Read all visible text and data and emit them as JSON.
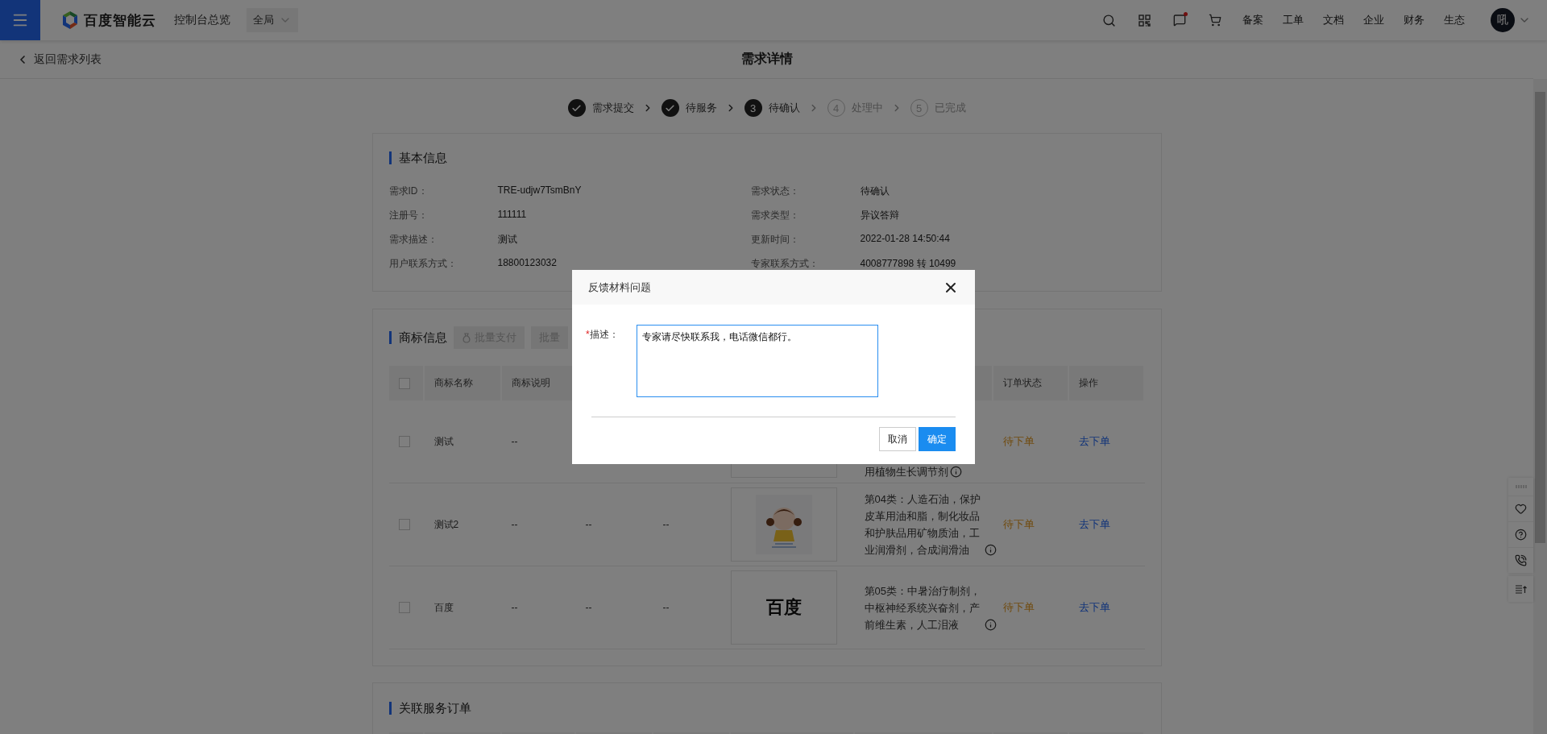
{
  "topbar": {
    "brand": "百度智能云",
    "console": "控制台总览",
    "region": "全局",
    "nav": [
      "备案",
      "工单",
      "文档",
      "企业",
      "财务",
      "生态"
    ],
    "avatar": "吼",
    "unread": true
  },
  "subheader": {
    "back": "返回需求列表",
    "title": "需求详情"
  },
  "steps": [
    {
      "label": "需求提交",
      "kind": "done"
    },
    {
      "label": "待服务",
      "kind": "done"
    },
    {
      "number": "3",
      "label": "待确认",
      "kind": "current"
    },
    {
      "number": "4",
      "label": "处理中",
      "kind": "pending"
    },
    {
      "number": "5",
      "label": "已完成",
      "kind": "pending"
    }
  ],
  "basic_info": {
    "title": "基本信息",
    "fields": [
      {
        "label": "需求ID：",
        "value": "TRE-udjw7TsmBnY"
      },
      {
        "label": "需求状态：",
        "value": "待确认"
      },
      {
        "label": "注册号：",
        "value": "111111"
      },
      {
        "label": "需求类型：",
        "value": "异议答辩"
      },
      {
        "label": "需求描述：",
        "value": "测试"
      },
      {
        "label": "更新时间：",
        "value": "2022-01-28 14:50:44"
      },
      {
        "label": "用户联系方式：",
        "value": "18800123032"
      },
      {
        "label": "专家联系方式：",
        "value": "4008777898 转 10499"
      }
    ]
  },
  "trademarks": {
    "title": "商标信息",
    "actions": [
      {
        "label": "批量支付",
        "icon": true,
        "disabled": true
      },
      {
        "label": "批量",
        "icon": false,
        "disabled": true
      }
    ],
    "select_all_checked": false,
    "columns": {
      "name": "商标名称",
      "description": "商标说明",
      "order_status": "订单状态",
      "action": "操作"
    },
    "rows": [
      {
        "checked": false,
        "name": "测试",
        "description": "--",
        "classes": "用植物生长调节剂",
        "order_status": "待下单",
        "action": "去下单"
      },
      {
        "checked": false,
        "name": "测试2",
        "description": "--",
        "column_3": "--",
        "column_4": "--",
        "classes": "第04类：人造石油，保护皮革用油和脂，制化妆品和护肤品用矿物质油，工业润滑剂，合成润滑油",
        "order_status": "待下单",
        "action": "去下单"
      },
      {
        "checked": false,
        "name": "百度",
        "description": "--",
        "column_3": "--",
        "column_4": "--",
        "image": {
          "kind": "wordmark",
          "text": "百度"
        },
        "classes": "第05类：中暑治疗制剂，中枢神经系统兴奋剂，产前维生素，人工泪液",
        "order_status": "待下单",
        "action": "去下单"
      }
    ]
  },
  "related_orders": {
    "title": "关联服务订单"
  },
  "modal": {
    "title": "反馈材料问题",
    "field": {
      "required_mark": "*",
      "label": "描述：",
      "value": "专家请尽快联系我，电话微信都行。"
    },
    "buttons": [
      {
        "label": "取消",
        "kind": "secondary"
      },
      {
        "label": "确定",
        "kind": "primary"
      }
    ]
  }
}
